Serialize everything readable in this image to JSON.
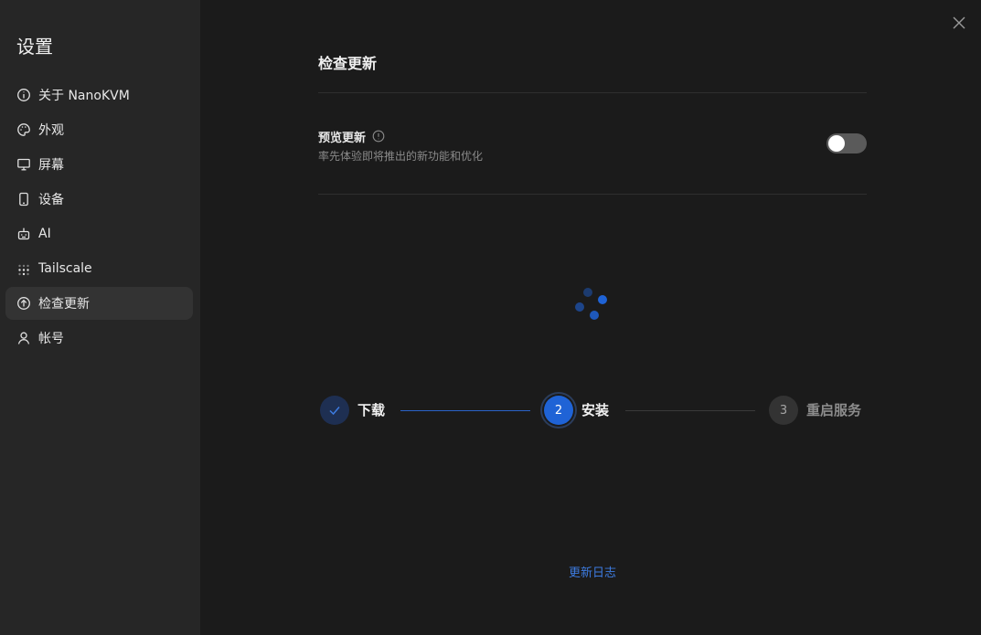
{
  "sidebar": {
    "title": "设置",
    "items": [
      {
        "label": "关于 NanoKVM",
        "icon": "info-icon"
      },
      {
        "label": "外观",
        "icon": "palette-icon"
      },
      {
        "label": "屏幕",
        "icon": "monitor-icon"
      },
      {
        "label": "设备",
        "icon": "device-icon"
      },
      {
        "label": "AI",
        "icon": "robot-icon"
      },
      {
        "label": "Tailscale",
        "icon": "tailscale-icon"
      },
      {
        "label": "检查更新",
        "icon": "upload-circle-icon",
        "active": true
      },
      {
        "label": "帐号",
        "icon": "user-icon"
      }
    ]
  },
  "main": {
    "title": "检查更新",
    "preview": {
      "title": "预览更新",
      "description": "率先体验即将推出的新功能和优化",
      "enabled": false
    },
    "steps": [
      {
        "label": "下载",
        "status": "done"
      },
      {
        "number": "2",
        "label": "安装",
        "status": "current"
      },
      {
        "number": "3",
        "label": "重启服务",
        "status": "pending"
      }
    ],
    "changelog_link": "更新日志"
  },
  "colors": {
    "accent": "#1f63d6",
    "link": "#3d7be0",
    "sidebar_bg": "#262626",
    "main_bg": "#1b1b1b"
  }
}
